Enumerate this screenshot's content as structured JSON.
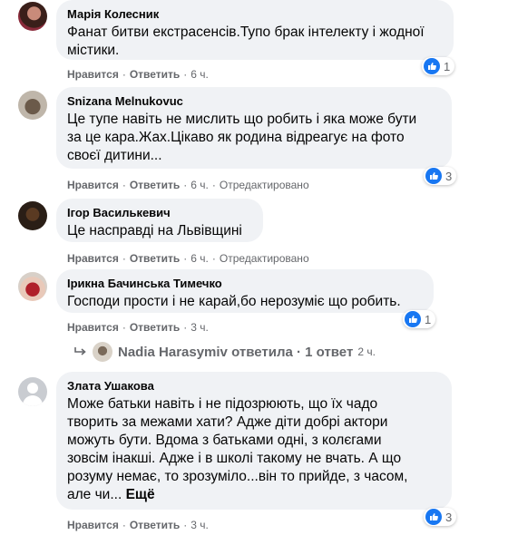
{
  "comments": [
    {
      "author": "Марія Колесник",
      "lines": [
        "Фанат битви екстрасенсів.Тупо брак інтелекту і жодної",
        "містики."
      ],
      "like_label": "Нравится",
      "reply_label": "Ответить",
      "time": "6 ч.",
      "reactions": "1"
    },
    {
      "author": "Snizana Melnukovuc",
      "lines": [
        "Це тупе навіть не мислить що робить і яка може бути",
        "за це кара.Жах.Цікаво як родина відреагує на фото",
        "своєї дитини..."
      ],
      "like_label": "Нравится",
      "reply_label": "Ответить",
      "time": "6 ч.",
      "edited": "Отредактировано",
      "reactions": "3"
    },
    {
      "author": "Ігор Василькевич",
      "lines": [
        "Це насправді на Львівщині"
      ],
      "like_label": "Нравится",
      "reply_label": "Ответить",
      "time": "6 ч.",
      "edited": "Отредактировано"
    },
    {
      "author": "Ірикна Бачинська Тимечко",
      "lines": [
        "Господи прости і не карай,бо нерозуміє що робить."
      ],
      "like_label": "Нравится",
      "reply_label": "Ответить",
      "time": "3 ч.",
      "reactions": "1",
      "replies": {
        "text": "Nadia Harasymiv ответила · 1 ответ",
        "time": "2 ч."
      }
    },
    {
      "author": "Злата Ушакова",
      "lines": [
        "Може батьки навіть і не підозрюють, що їх чадо",
        "творить за межами хати? Адже діти добрі актори",
        "можуть бути. Вдома з батьками одні, з колєгами",
        "зовсім інакші. Адже і в школі такому не вчать. А що",
        "розуму немає, то зрозуміло...він то прийде, з часом,"
      ],
      "last_line": "але чи...",
      "more_label": "Ещё",
      "like_label": "Нравится",
      "reply_label": "Ответить",
      "time": "3 ч.",
      "reactions": "3"
    }
  ],
  "colors": {
    "bubble": "#f0f2f5",
    "meta": "#65676b",
    "like_blue": "#1877f2"
  },
  "icons": {
    "like": "thumbs-up-icon",
    "reply": "reply-arrow-icon"
  }
}
